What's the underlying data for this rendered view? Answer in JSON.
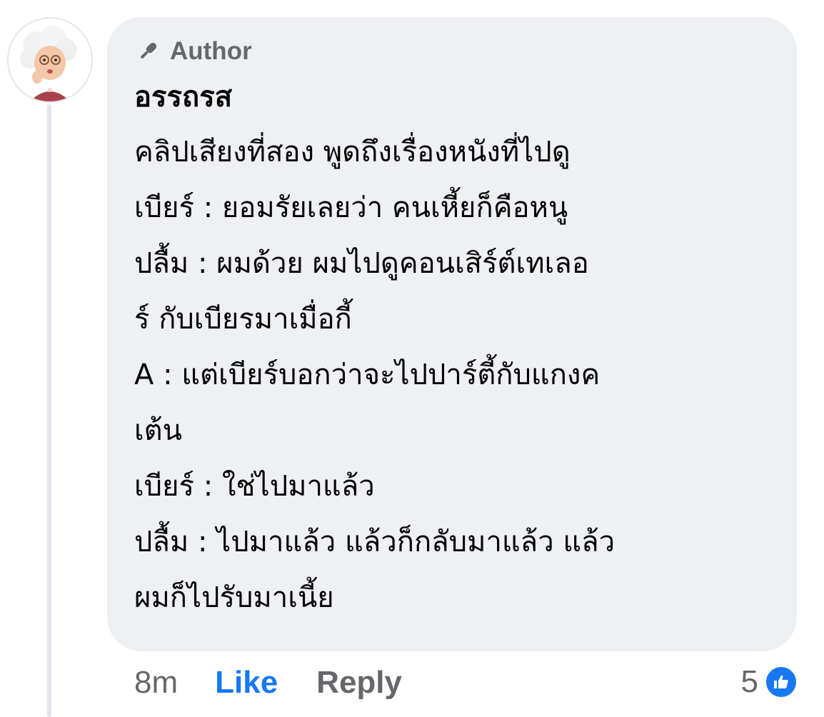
{
  "comment": {
    "author_badge_label": "Author",
    "author_badge_icon": "microphone-icon",
    "commenter_name": "อรรถรส",
    "body_lines": [
      "คลิปเสียงที่สอง พูดถึงเรื่องหนังที่ไปดู",
      "เบียร์ : ยอมรัยเลยว่า คนเหี้ยก็คือหนู",
      "ปลื้ม : ผมด้วย ผมไปดูคอนเสิร์ต์เทเลอ",
      "ร์ กับเบียรมาเมื่อกี้",
      "A : แต่เบียร์บอกว่าจะไปปาร์ตี้กับแกงค",
      "เต้น",
      "เบียร์ : ใช่ไปมาแล้ว",
      "ปลื้ม : ไปมาแล้ว แล้วก็กลับมาแล้ว แล้ว",
      "ผมก็ไปรับมาเนี้ย"
    ],
    "timestamp": "8m",
    "like_label": "Like",
    "reply_label": "Reply",
    "reaction_count": "5",
    "reaction_icon": "thumbs-up-icon"
  },
  "colors": {
    "bubble_bg": "#eff0f4",
    "secondary_text": "#65676b",
    "primary_text": "#050505",
    "like_blue": "#1877f2"
  }
}
